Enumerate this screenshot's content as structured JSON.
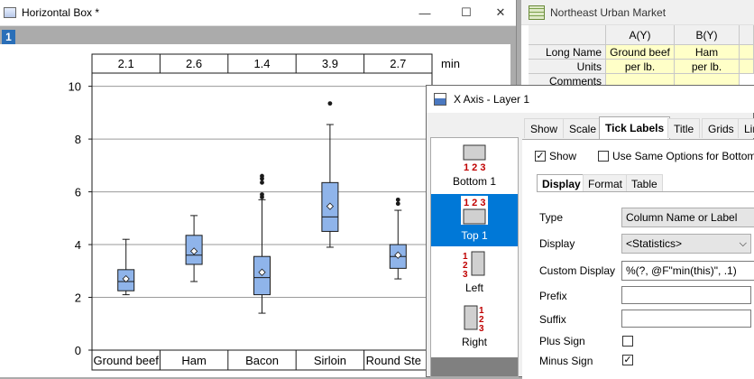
{
  "graph_window": {
    "title": "Horizontal Box *",
    "layer_badge": "1",
    "controls": {
      "minimize": "—",
      "maximize": "☐",
      "close": "✕"
    }
  },
  "chart_data": {
    "type": "box",
    "categories": [
      "Ground beef",
      "Ham",
      "Bacon",
      "Sirloin",
      "Round Ste"
    ],
    "top_labels": [
      "2.1",
      "2.6",
      "1.4",
      "3.9",
      "2.7"
    ],
    "top_axis_unit": "min",
    "ylim": [
      0,
      10.5
    ],
    "yticks": [
      "0",
      "2",
      "4",
      "6",
      "8",
      "10"
    ],
    "grid": true,
    "boxes": [
      {
        "min": 2.1,
        "q1": 2.25,
        "median": 2.6,
        "q3": 3.05,
        "max": 4.2,
        "mean": 2.7,
        "outliers": []
      },
      {
        "min": 2.6,
        "q1": 3.25,
        "median": 3.6,
        "q3": 4.35,
        "max": 5.1,
        "mean": 3.75,
        "outliers": []
      },
      {
        "min": 1.4,
        "q1": 2.1,
        "median": 2.75,
        "q3": 3.55,
        "max": 5.7,
        "mean": 2.95,
        "outliers": [
          5.8,
          5.9,
          6.35,
          6.5,
          6.6
        ]
      },
      {
        "min": 3.9,
        "q1": 4.5,
        "median": 5.05,
        "q3": 6.35,
        "max": 8.55,
        "mean": 5.45,
        "outliers": [
          9.35
        ]
      },
      {
        "min": 2.7,
        "q1": 3.1,
        "median": 3.55,
        "q3": 4.0,
        "max": 5.3,
        "mean": 3.6,
        "outliers": [
          5.55,
          5.7
        ]
      }
    ],
    "colors": {
      "box_fill": "#8fb4ea",
      "box_stroke": "#1a1a1a",
      "grid": "#9a9a9a"
    }
  },
  "worksheet": {
    "title": "Northeast Urban Market",
    "columns": [
      "A(Y)",
      "B(Y)"
    ],
    "rows": [
      {
        "label": "Long Name",
        "cells": [
          "Ground beef",
          "Ham"
        ]
      },
      {
        "label": "Units",
        "cells": [
          "per lb.",
          "per lb."
        ]
      },
      {
        "label": "Comments",
        "cells": [
          "",
          ""
        ]
      }
    ]
  },
  "dialog": {
    "title": "X Axis - Layer 1",
    "axis_list": [
      {
        "label": "Bottom 1",
        "selected": false
      },
      {
        "label": "Top 1",
        "selected": true
      },
      {
        "label": "Left",
        "selected": false
      },
      {
        "label": "Right",
        "selected": false
      }
    ],
    "tabs": [
      "Show",
      "Scale",
      "Tick Labels",
      "Title",
      "Grids",
      "Line"
    ],
    "active_tab": "Tick Labels",
    "show_label": "Show",
    "same_options_label": "Use Same Options for Bottom",
    "subtabs": [
      "Display",
      "Format",
      "Table"
    ],
    "active_subtab": "Display",
    "type_label": "Type",
    "type_value": "Column Name or Label",
    "display_label": "Display",
    "display_value": "<Statistics>",
    "custom_display_label": "Custom Display",
    "custom_display_value": "%(?, @F\"min(this)\", .1)",
    "prefix_label": "Prefix",
    "suffix_label": "Suffix",
    "plus_sign_label": "Plus Sign",
    "minus_sign_label": "Minus Sign",
    "check_mark": "✓"
  }
}
